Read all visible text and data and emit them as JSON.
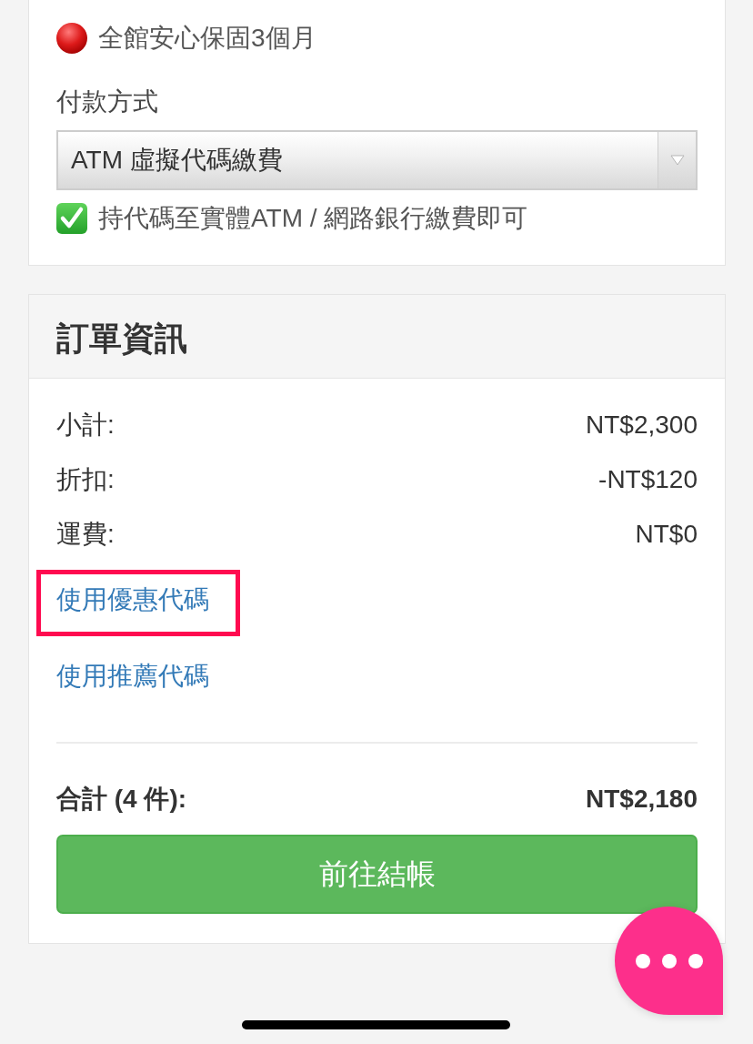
{
  "notice": {
    "text": "全館安心保固3個月"
  },
  "payment": {
    "label": "付款方式",
    "select": {
      "value": "ATM 虛擬代碼繳費"
    },
    "hint": "持代碼至實體ATM / 網路銀行繳費即可"
  },
  "order": {
    "title": "訂單資訊",
    "rows": [
      {
        "label": "小計:",
        "value": "NT$2,300"
      },
      {
        "label": "折扣:",
        "value": "-NT$120"
      },
      {
        "label": "運費:",
        "value": "NT$0"
      }
    ],
    "links": [
      {
        "text": "使用優惠代碼",
        "highlighted": true
      },
      {
        "text": "使用推薦代碼",
        "highlighted": false
      }
    ],
    "total": {
      "label": "合計 (4 件):",
      "value": "NT$2,180"
    },
    "checkout_button": {
      "label": "前往結帳"
    }
  }
}
